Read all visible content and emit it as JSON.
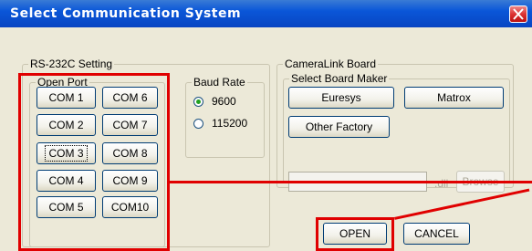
{
  "window": {
    "title": "Select Communication System"
  },
  "rs232": {
    "group_label": "RS-232C Setting",
    "open_port_label": "Open Port",
    "ports": [
      "COM 1",
      "COM 6",
      "COM 2",
      "COM 7",
      "COM 3",
      "COM 8",
      "COM 4",
      "COM 9",
      "COM 5",
      "COM10"
    ],
    "focused_port": "COM 3",
    "baud": {
      "label": "Baud Rate",
      "options": [
        "9600",
        "115200"
      ],
      "selected": "9600"
    }
  },
  "cameralink": {
    "group_label": "CameraLink Board",
    "maker_label": "Select Board Maker",
    "euresys_label": "Euresys",
    "matrox_label": "Matrox",
    "other_label": "Other Factory",
    "dll_value": "",
    "dll_suffix": ".dll",
    "browse_label": "Browse"
  },
  "actions": {
    "open_label": "OPEN",
    "cancel_label": "CANCEL"
  },
  "colors": {
    "highlight": "#e00000",
    "titlebar": "#0a56d8",
    "face": "#ece9d8"
  }
}
